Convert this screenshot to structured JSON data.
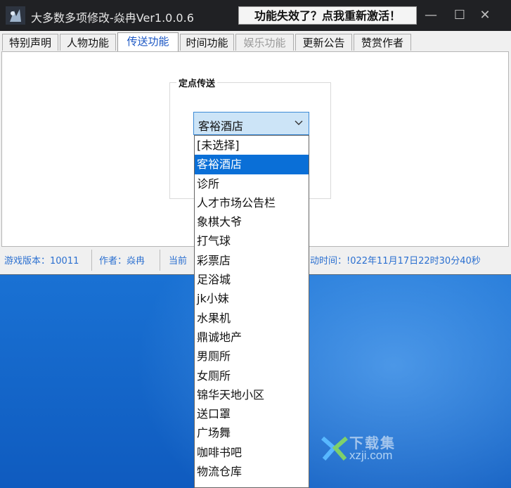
{
  "window": {
    "title": "大多数多项修改-焱冉Ver1.0.0.6",
    "reactivate_button": "功能失效了？点我重新激活！",
    "controls": {
      "minimize": "—",
      "maximize": "☐",
      "close": "✕"
    }
  },
  "tabs": [
    {
      "label": "特别声明",
      "state": "normal"
    },
    {
      "label": "人物功能",
      "state": "normal"
    },
    {
      "label": "传送功能",
      "state": "active"
    },
    {
      "label": "时间功能",
      "state": "normal"
    },
    {
      "label": "娱乐功能",
      "state": "disabled"
    },
    {
      "label": "更新公告",
      "state": "normal"
    },
    {
      "label": "赞赏作者",
      "state": "normal"
    }
  ],
  "teleport": {
    "group_label": "定点传送",
    "selected": "客裕酒店",
    "options": [
      "[未选择]",
      "客裕酒店",
      "诊所",
      "人才市场公告栏",
      "象棋大爷",
      "打气球",
      "彩票店",
      "足浴城",
      "jk小妹",
      "水果机",
      "鼎诚地产",
      "男厕所",
      "女厕所",
      "锦华天地小区",
      "送口罩",
      "广场舞",
      "咖啡书吧",
      "物流仓库"
    ],
    "selected_index": 1
  },
  "status": {
    "game_version": "游戏版本：10011",
    "author": "作者：焱冉",
    "current": "当前",
    "launch_time": "动时间：!022年11月17日22时30分40秒"
  },
  "watermark": {
    "cn": "下载集",
    "en": "xzji.com"
  },
  "colors": {
    "accent": "#0a6fd7",
    "titlebar": "#202124",
    "status_text": "#2a6fd0"
  }
}
